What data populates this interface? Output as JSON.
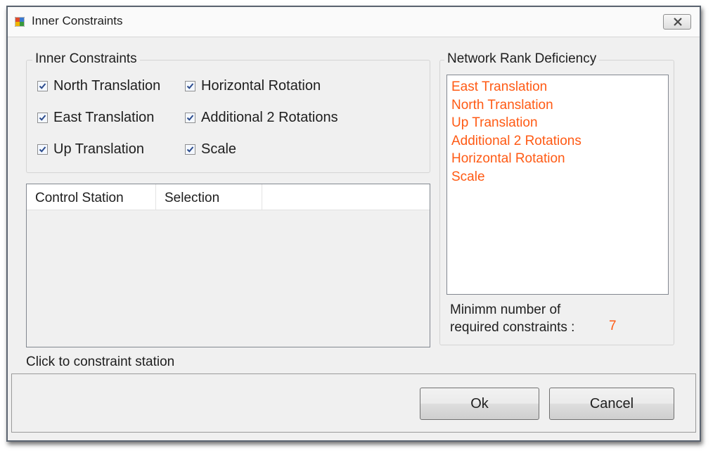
{
  "window": {
    "title": "Inner Constraints",
    "close_icon": "close-icon"
  },
  "inner_constraints": {
    "group_label": "Inner Constraints",
    "checkboxes": [
      {
        "label": "North Translation",
        "checked": true
      },
      {
        "label": "Horizontal Rotation",
        "checked": true
      },
      {
        "label": "East Translation",
        "checked": true
      },
      {
        "label": "Additional 2 Rotations",
        "checked": true
      },
      {
        "label": "Up Translation",
        "checked": true
      },
      {
        "label": "Scale",
        "checked": true
      }
    ]
  },
  "stations_table": {
    "columns": [
      "Control Station",
      "Selection",
      ""
    ],
    "rows": []
  },
  "status_text": "Click to constraint station",
  "network_rank": {
    "group_label": "Network Rank Deficiency",
    "items": [
      "East Translation",
      "North Translation",
      "Up Translation",
      "Additional 2 Rotations",
      "Horizontal Rotation",
      "Scale"
    ],
    "min_label_line1": "Minimm number of",
    "min_label_line2": "required constraints :",
    "min_value": "7"
  },
  "buttons": {
    "ok": "Ok",
    "cancel": "Cancel"
  },
  "colors": {
    "accent_orange": "#ff5a14",
    "window_bg": "#f0f0f0"
  }
}
